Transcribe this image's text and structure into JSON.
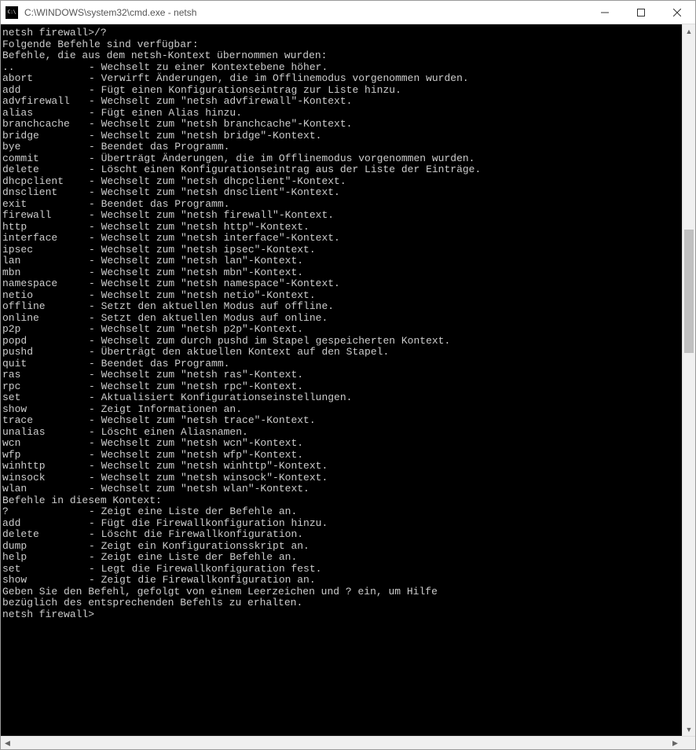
{
  "window": {
    "title": "C:\\WINDOWS\\system32\\cmd.exe - netsh"
  },
  "terminal": {
    "blank_top": "",
    "prompt_with_cmd": "netsh firewall>/?",
    "blank_after_prompt": "",
    "header1": "Folgende Befehle sind verfügbar:",
    "blank2": "",
    "header2": "Befehle, die aus dem netsh-Kontext übernommen wurden:",
    "inherited_commands": [
      {
        "cmd": "..",
        "desc": "- Wechselt zu einer Kontextebene höher."
      },
      {
        "cmd": "abort",
        "desc": "- Verwirft Änderungen, die im Offlinemodus vorgenommen wurden."
      },
      {
        "cmd": "add",
        "desc": "- Fügt einen Konfigurationseintrag zur Liste hinzu."
      },
      {
        "cmd": "advfirewall",
        "desc": "- Wechselt zum \"netsh advfirewall\"-Kontext."
      },
      {
        "cmd": "alias",
        "desc": "- Fügt einen Alias hinzu."
      },
      {
        "cmd": "branchcache",
        "desc": "- Wechselt zum \"netsh branchcache\"-Kontext."
      },
      {
        "cmd": "bridge",
        "desc": "- Wechselt zum \"netsh bridge\"-Kontext."
      },
      {
        "cmd": "bye",
        "desc": "- Beendet das Programm."
      },
      {
        "cmd": "commit",
        "desc": "- Überträgt Änderungen, die im Offlinemodus vorgenommen wurden."
      },
      {
        "cmd": "delete",
        "desc": "- Löscht einen Konfigurationseintrag aus der Liste der Einträge."
      },
      {
        "cmd": "dhcpclient",
        "desc": "- Wechselt zum \"netsh dhcpclient\"-Kontext."
      },
      {
        "cmd": "dnsclient",
        "desc": "- Wechselt zum \"netsh dnsclient\"-Kontext."
      },
      {
        "cmd": "exit",
        "desc": "- Beendet das Programm."
      },
      {
        "cmd": "firewall",
        "desc": "- Wechselt zum \"netsh firewall\"-Kontext."
      },
      {
        "cmd": "http",
        "desc": "- Wechselt zum \"netsh http\"-Kontext."
      },
      {
        "cmd": "interface",
        "desc": "- Wechselt zum \"netsh interface\"-Kontext."
      },
      {
        "cmd": "ipsec",
        "desc": "- Wechselt zum \"netsh ipsec\"-Kontext."
      },
      {
        "cmd": "lan",
        "desc": "- Wechselt zum \"netsh lan\"-Kontext."
      },
      {
        "cmd": "mbn",
        "desc": "- Wechselt zum \"netsh mbn\"-Kontext."
      },
      {
        "cmd": "namespace",
        "desc": "- Wechselt zum \"netsh namespace\"-Kontext."
      },
      {
        "cmd": "netio",
        "desc": "- Wechselt zum \"netsh netio\"-Kontext."
      },
      {
        "cmd": "offline",
        "desc": "- Setzt den aktuellen Modus auf offline."
      },
      {
        "cmd": "online",
        "desc": "- Setzt den aktuellen Modus auf online."
      },
      {
        "cmd": "p2p",
        "desc": "- Wechselt zum \"netsh p2p\"-Kontext."
      },
      {
        "cmd": "popd",
        "desc": "- Wechselt zum durch pushd im Stapel gespeicherten Kontext."
      },
      {
        "cmd": "pushd",
        "desc": "- Überträgt den aktuellen Kontext auf den Stapel."
      },
      {
        "cmd": "quit",
        "desc": "- Beendet das Programm."
      },
      {
        "cmd": "ras",
        "desc": "- Wechselt zum \"netsh ras\"-Kontext."
      },
      {
        "cmd": "rpc",
        "desc": "- Wechselt zum \"netsh rpc\"-Kontext."
      },
      {
        "cmd": "set",
        "desc": "- Aktualisiert Konfigurationseinstellungen."
      },
      {
        "cmd": "show",
        "desc": "- Zeigt Informationen an."
      },
      {
        "cmd": "trace",
        "desc": "- Wechselt zum \"netsh trace\"-Kontext."
      },
      {
        "cmd": "unalias",
        "desc": "- Löscht einen Aliasnamen."
      },
      {
        "cmd": "wcn",
        "desc": "- Wechselt zum \"netsh wcn\"-Kontext."
      },
      {
        "cmd": "wfp",
        "desc": "- Wechselt zum \"netsh wfp\"-Kontext."
      },
      {
        "cmd": "winhttp",
        "desc": "- Wechselt zum \"netsh winhttp\"-Kontext."
      },
      {
        "cmd": "winsock",
        "desc": "- Wechselt zum \"netsh winsock\"-Kontext."
      },
      {
        "cmd": "wlan",
        "desc": "- Wechselt zum \"netsh wlan\"-Kontext."
      }
    ],
    "blank3": "",
    "header3": "Befehle in diesem Kontext:",
    "context_commands": [
      {
        "cmd": "?",
        "desc": "- Zeigt eine Liste der Befehle an."
      },
      {
        "cmd": "add",
        "desc": "- Fügt die Firewallkonfiguration hinzu."
      },
      {
        "cmd": "delete",
        "desc": "- Löscht die Firewallkonfiguration."
      },
      {
        "cmd": "dump",
        "desc": "- Zeigt ein Konfigurationsskript an."
      },
      {
        "cmd": "help",
        "desc": "- Zeigt eine Liste der Befehle an."
      },
      {
        "cmd": "set",
        "desc": "- Legt die Firewallkonfiguration fest."
      },
      {
        "cmd": "show",
        "desc": "- Zeigt die Firewallkonfiguration an."
      }
    ],
    "blank4": "",
    "hint1": "Geben Sie den Befehl, gefolgt von einem Leerzeichen und ? ein, um Hilfe",
    "hint2": "bezüglich des entsprechenden Befehls zu erhalten.",
    "blank5": "",
    "prompt_end": "netsh firewall>"
  }
}
